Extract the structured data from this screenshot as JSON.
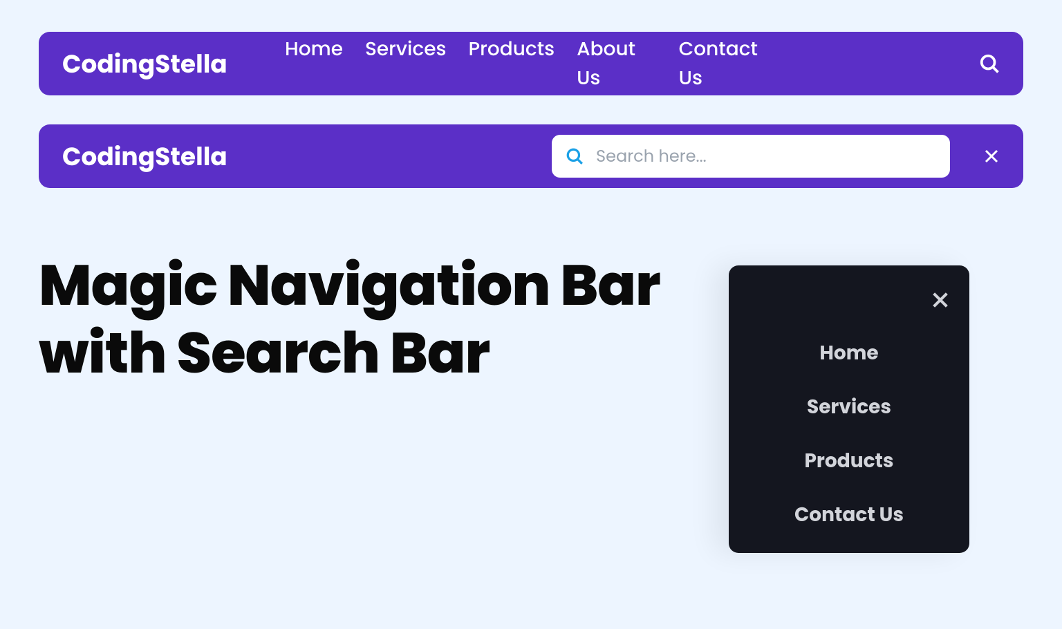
{
  "brand": "CodingStella",
  "nav": {
    "items": [
      "Home",
      "Services",
      "Products",
      "About Us",
      "Contact Us"
    ]
  },
  "search": {
    "placeholder": "Search here..."
  },
  "headline": {
    "line1": "Magic Navigation Bar",
    "line2": "with Search Bar"
  },
  "mobile_menu": {
    "items": [
      "Home",
      "Services",
      "Products",
      "Contact Us"
    ]
  },
  "colors": {
    "primary": "#5b2fc7",
    "bg": "#edf5ff",
    "dark": "#14161f",
    "search_icon": "#1aa0e6"
  }
}
